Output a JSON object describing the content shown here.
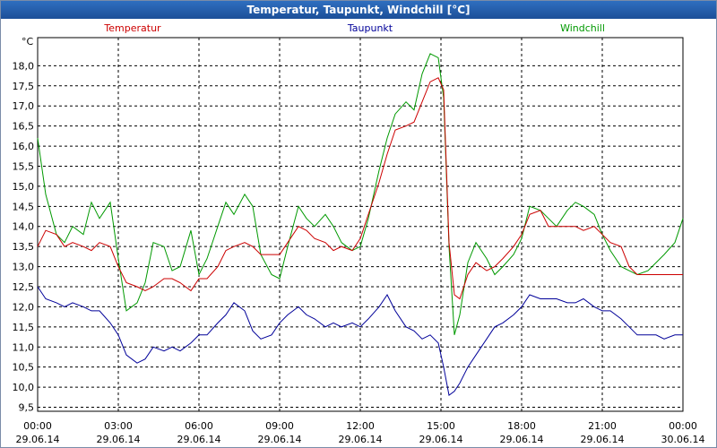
{
  "window": {
    "title": "Temperatur, Taupunkt, Windchill [°C]"
  },
  "chart_data": {
    "type": "line",
    "title": "Temperatur, Taupunkt, Windchill [°C]",
    "ylabel": "°C",
    "ylim": [
      9.4,
      18.7
    ],
    "y_ticks": [
      "9,5",
      "10,0",
      "10,5",
      "11,0",
      "11,5",
      "12,0",
      "12,5",
      "13,0",
      "13,5",
      "14,0",
      "14,5",
      "15,0",
      "15,5",
      "16,0",
      "16,5",
      "17,0",
      "17,5",
      "18,0"
    ],
    "x_ticks": [
      {
        "time": "00:00",
        "date": "29.06.14"
      },
      {
        "time": "03:00",
        "date": "29.06.14"
      },
      {
        "time": "06:00",
        "date": "29.06.14"
      },
      {
        "time": "09:00",
        "date": "29.06.14"
      },
      {
        "time": "12:00",
        "date": "29.06.14"
      },
      {
        "time": "15:00",
        "date": "29.06.14"
      },
      {
        "time": "18:00",
        "date": "29.06.14"
      },
      {
        "time": "21:00",
        "date": "29.06.14"
      },
      {
        "time": "00:00",
        "date": "30.06.14"
      }
    ],
    "grid": true,
    "legend_position": "top",
    "x_unit": "hours since 00:00 29.06.14",
    "series": [
      {
        "name": "Temperatur",
        "color": "#cc0000",
        "x": [
          0,
          0.3,
          0.7,
          1,
          1.3,
          1.7,
          2,
          2.3,
          2.7,
          3,
          3.3,
          3.7,
          4,
          4.3,
          4.7,
          5,
          5.3,
          5.7,
          6,
          6.3,
          6.7,
          7,
          7.3,
          7.7,
          8,
          8.3,
          8.7,
          9,
          9.3,
          9.7,
          10,
          10.3,
          10.7,
          11,
          11.3,
          11.7,
          12,
          12.3,
          12.7,
          13,
          13.3,
          13.7,
          14,
          14.3,
          14.6,
          14.9,
          15.1,
          15.3,
          15.5,
          15.7,
          16,
          16.3,
          16.7,
          17,
          17.3,
          17.7,
          18,
          18.3,
          18.7,
          19,
          19.3,
          19.7,
          20,
          20.3,
          20.7,
          21,
          21.3,
          21.7,
          22,
          22.3,
          22.7,
          23,
          23.3,
          23.7,
          24
        ],
        "y": [
          13.5,
          13.9,
          13.8,
          13.5,
          13.6,
          13.5,
          13.4,
          13.6,
          13.5,
          13.0,
          12.6,
          12.5,
          12.4,
          12.5,
          12.7,
          12.7,
          12.6,
          12.4,
          12.7,
          12.7,
          13.0,
          13.4,
          13.5,
          13.6,
          13.5,
          13.3,
          13.3,
          13.3,
          13.6,
          14.0,
          13.9,
          13.7,
          13.6,
          13.4,
          13.5,
          13.4,
          13.7,
          14.3,
          15.1,
          15.8,
          16.4,
          16.5,
          16.6,
          17.1,
          17.6,
          17.7,
          17.4,
          13.6,
          12.3,
          12.2,
          12.8,
          13.1,
          12.9,
          13.0,
          13.2,
          13.5,
          13.8,
          14.3,
          14.4,
          14.0,
          14.0,
          14.0,
          14.0,
          13.9,
          14.0,
          13.8,
          13.6,
          13.5,
          13.0,
          12.8,
          12.8,
          12.8,
          12.8,
          12.8,
          12.8
        ]
      },
      {
        "name": "Taupunkt",
        "color": "#000099",
        "x": [
          0,
          0.3,
          0.7,
          1,
          1.3,
          1.7,
          2,
          2.3,
          2.7,
          3,
          3.3,
          3.7,
          4,
          4.3,
          4.7,
          5,
          5.3,
          5.7,
          6,
          6.3,
          6.7,
          7,
          7.3,
          7.7,
          8,
          8.3,
          8.7,
          9,
          9.3,
          9.7,
          10,
          10.3,
          10.7,
          11,
          11.3,
          11.7,
          12,
          12.3,
          12.7,
          13,
          13.3,
          13.7,
          14,
          14.3,
          14.6,
          14.9,
          15.1,
          15.3,
          15.5,
          15.7,
          16,
          16.3,
          16.7,
          17,
          17.3,
          17.7,
          18,
          18.3,
          18.7,
          19,
          19.3,
          19.7,
          20,
          20.3,
          20.7,
          21,
          21.3,
          21.7,
          22,
          22.3,
          22.7,
          23,
          23.3,
          23.7,
          24
        ],
        "y": [
          12.5,
          12.2,
          12.1,
          12.0,
          12.1,
          12.0,
          11.9,
          11.9,
          11.6,
          11.3,
          10.8,
          10.6,
          10.7,
          11.0,
          10.9,
          11.0,
          10.9,
          11.1,
          11.3,
          11.3,
          11.6,
          11.8,
          12.1,
          11.9,
          11.4,
          11.2,
          11.3,
          11.6,
          11.8,
          12.0,
          11.8,
          11.7,
          11.5,
          11.6,
          11.5,
          11.6,
          11.5,
          11.7,
          12.0,
          12.3,
          11.9,
          11.5,
          11.4,
          11.2,
          11.3,
          11.1,
          10.5,
          9.8,
          9.9,
          10.1,
          10.5,
          10.8,
          11.2,
          11.5,
          11.6,
          11.8,
          12.0,
          12.3,
          12.2,
          12.2,
          12.2,
          12.1,
          12.1,
          12.2,
          12.0,
          11.9,
          11.9,
          11.7,
          11.5,
          11.3,
          11.3,
          11.3,
          11.2,
          11.3,
          11.3
        ]
      },
      {
        "name": "Windchill",
        "color": "#009900",
        "x": [
          0,
          0.3,
          0.7,
          1,
          1.3,
          1.7,
          2,
          2.3,
          2.7,
          3,
          3.3,
          3.7,
          4,
          4.3,
          4.7,
          5,
          5.3,
          5.7,
          6,
          6.3,
          6.7,
          7,
          7.3,
          7.7,
          8,
          8.3,
          8.7,
          9,
          9.3,
          9.7,
          10,
          10.3,
          10.7,
          11,
          11.3,
          11.7,
          12,
          12.3,
          12.7,
          13,
          13.3,
          13.7,
          14,
          14.3,
          14.6,
          14.9,
          15.1,
          15.3,
          15.5,
          15.7,
          16,
          16.3,
          16.7,
          17,
          17.3,
          17.7,
          18,
          18.3,
          18.7,
          19,
          19.3,
          19.7,
          20,
          20.3,
          20.7,
          21,
          21.3,
          21.7,
          22,
          22.3,
          22.7,
          23,
          23.3,
          23.7,
          24
        ],
        "y": [
          16.2,
          14.8,
          13.8,
          13.6,
          14.0,
          13.8,
          14.6,
          14.2,
          14.6,
          13.2,
          11.9,
          12.1,
          12.6,
          13.6,
          13.5,
          12.9,
          13.0,
          13.9,
          12.8,
          13.2,
          14.0,
          14.6,
          14.3,
          14.8,
          14.5,
          13.3,
          12.8,
          12.7,
          13.5,
          14.5,
          14.2,
          14.0,
          14.3,
          14.0,
          13.6,
          13.4,
          13.5,
          14.2,
          15.4,
          16.2,
          16.8,
          17.1,
          16.9,
          17.8,
          18.3,
          18.2,
          17.2,
          13.5,
          11.3,
          11.8,
          13.1,
          13.6,
          13.2,
          12.8,
          13.0,
          13.3,
          13.7,
          14.5,
          14.4,
          14.2,
          14.0,
          14.4,
          14.6,
          14.5,
          14.3,
          13.8,
          13.4,
          13.0,
          12.9,
          12.8,
          12.9,
          13.1,
          13.3,
          13.6,
          14.2
        ]
      }
    ]
  }
}
